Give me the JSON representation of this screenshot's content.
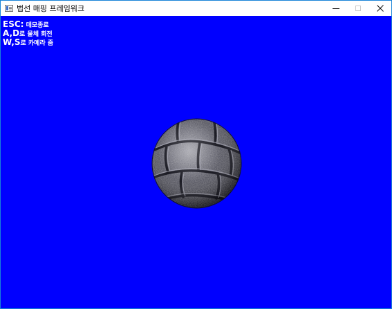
{
  "window": {
    "title": "법선 매핑 프레임워크",
    "icon": "app-window-icon",
    "controls": [
      "minimize-icon",
      "maximize-icon",
      "close-icon"
    ]
  },
  "viewport": {
    "background_color": "#0000ff",
    "help_text_color": "#ffffff",
    "help_lines": [
      {
        "key": "ESC:",
        "desc": " 데모종료"
      },
      {
        "key": "A,D",
        "desc": "로 물체 회전"
      },
      {
        "key": "W,S",
        "desc": "로 카메라 줌"
      }
    ]
  },
  "scene": {
    "object": "normal-mapped stone sphere"
  }
}
